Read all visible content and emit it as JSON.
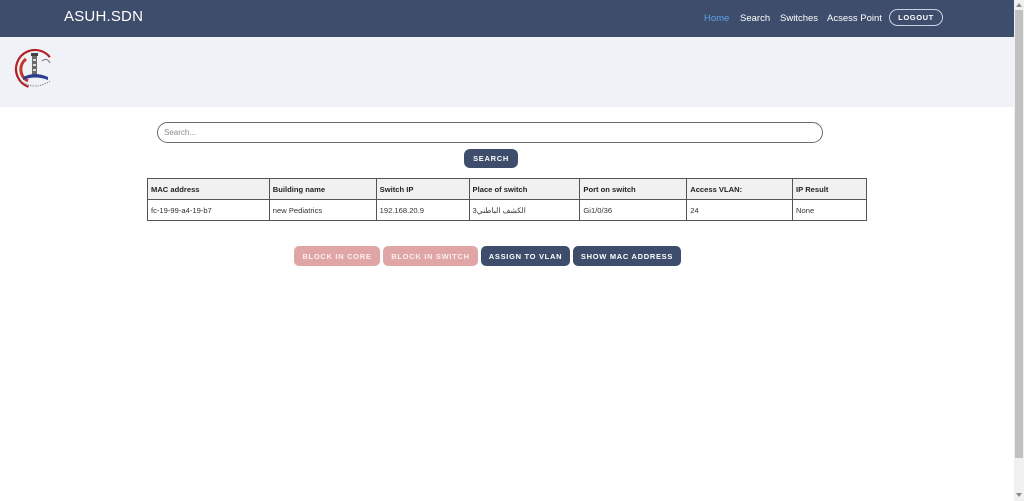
{
  "header": {
    "brand": "ASUH.SDN",
    "nav": [
      {
        "label": "Home",
        "active": true
      },
      {
        "label": "Search",
        "active": false
      },
      {
        "label": "Switches",
        "active": false
      },
      {
        "label": "Acsess Point",
        "active": false
      }
    ],
    "logout_label": "LOGOUT"
  },
  "logo": {
    "icon": "university-emblem-icon"
  },
  "search": {
    "placeholder": "Search...",
    "value": "",
    "button_label": "SEARCH"
  },
  "table": {
    "columns": [
      "MAC address",
      "Building name",
      "Switch IP",
      "Place of switch",
      "Port on switch",
      "Access VLAN:",
      "IP Result"
    ],
    "rows": [
      [
        "fc-19-99-a4-19-b7",
        "new Pediatrics",
        "192.168.20.9",
        "الكشف الباطني3",
        "Gi1/0/36",
        "24",
        "None"
      ]
    ]
  },
  "actions": {
    "block_core": "BLOCK IN CORE",
    "block_switch": "BLOCK IN SWITCH",
    "assign_vlan": "ASSIGN TO VLAN",
    "show_mac": "SHOW MAC ADDRESS"
  },
  "colors": {
    "navbar": "#3e4d6b",
    "banner": "#f1f2f8",
    "active_link": "#5aa3e6",
    "disabled_button": "#e0a6a6"
  }
}
